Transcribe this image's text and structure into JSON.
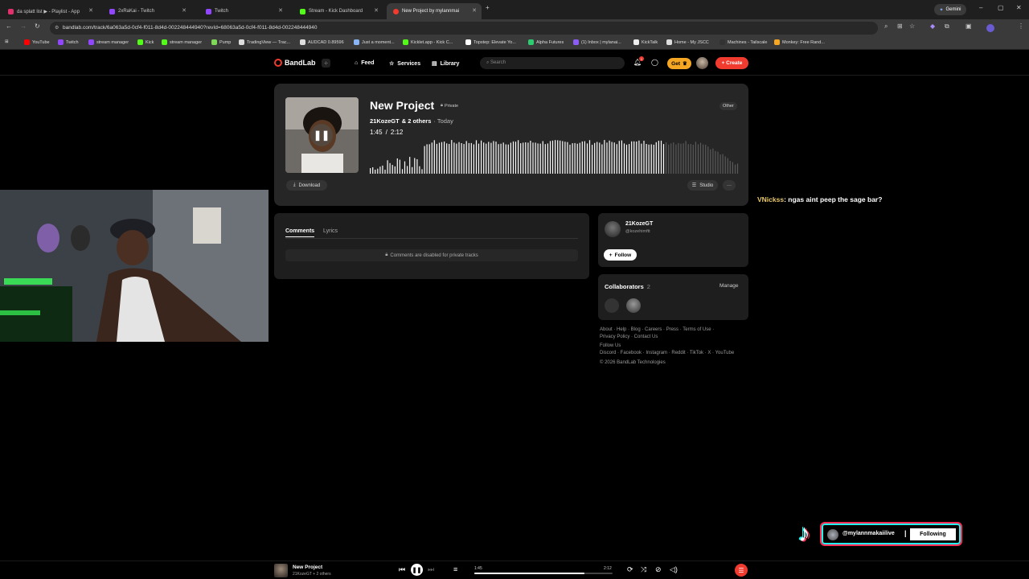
{
  "browser": {
    "tabs": [
      {
        "label": "da splatt list ▶ - Playlist - App",
        "color": "#e1306c"
      },
      {
        "label": "2xRaKai - Twitch",
        "color": "#9146ff"
      },
      {
        "label": "Twitch",
        "color": "#9146ff"
      },
      {
        "label": "Stream - Kick Dashboard",
        "color": "#53fc18"
      },
      {
        "label": "New Project by mylannmai",
        "color": "#f23b2f"
      }
    ],
    "gemini_label": "Gemini",
    "url": "bandlab.com/track/6a063a5d-0cf4-f011-8d4d-002248444940?revId=68063a5d-0cf4-f011-8d4d-002248444940",
    "bookmarks": [
      "YouTube",
      "Twitch",
      "stream manager",
      "Kick",
      "stream manager",
      "Pump",
      "TradingView — Trac...",
      "AUDCAD 0.89596",
      "Just a moment...",
      "Kicklet.app - Kick C...",
      "Topstep: Elevate Yo...",
      "Alpha Futures",
      "(1) Inbox | mylanai...",
      "KickTalk",
      "Home - My JSCC",
      "Machines - Tailscale",
      "Monkey: Free Rand..."
    ]
  },
  "bandlab": {
    "brand": "BandLab",
    "nav": {
      "feed": "Feed",
      "services": "Services",
      "library": "Library"
    },
    "search_placeholder": "Search",
    "notif_count": "1",
    "get_label": "Get",
    "create_label": "+ Create",
    "accent": "#f23b2f"
  },
  "track": {
    "title": "New Project",
    "privacy": "Private",
    "genre": "Other",
    "artist": "21KozeGT",
    "others": "& 2 others",
    "when": "· Today",
    "position": "1:45",
    "separator": "/",
    "duration": "2:12",
    "progress_fraction": 0.795,
    "download_label": "Download",
    "studio_label": "Studio",
    "more_label": "···"
  },
  "comments": {
    "tab_comments": "Comments",
    "tab_lyrics": "Lyrics",
    "disabled_msg": "Comments are disabled for private tracks"
  },
  "artist_card": {
    "name": "21KozeGT",
    "handle": "@kozehimftt",
    "follow_label": "Follow"
  },
  "collaborators": {
    "title": "Collaborators",
    "count": "2",
    "manage_label": "Manage"
  },
  "footer": {
    "line1": "About · Help · Blog · Careers · Press · Terms of Use ·",
    "line2": "Privacy Policy · Contact Us",
    "line3": "Follow Us",
    "line4": "Discord · Facebook · Instagram · Reddit · TikTok · X · YouTube",
    "copyright": "© 2026 BandLab Technologies"
  },
  "chat": {
    "user": "VNickss",
    "message": ": ngas aint peep the sage bar?"
  },
  "tiktok_overlay": {
    "handle": "@mylannmakaiilive",
    "divider": "|",
    "following_label": "Following"
  },
  "player": {
    "title": "New Project",
    "subtitle": "21KozeGT + 2 others",
    "position": "1:45",
    "duration": "2:12",
    "progress_fraction": 0.795
  }
}
